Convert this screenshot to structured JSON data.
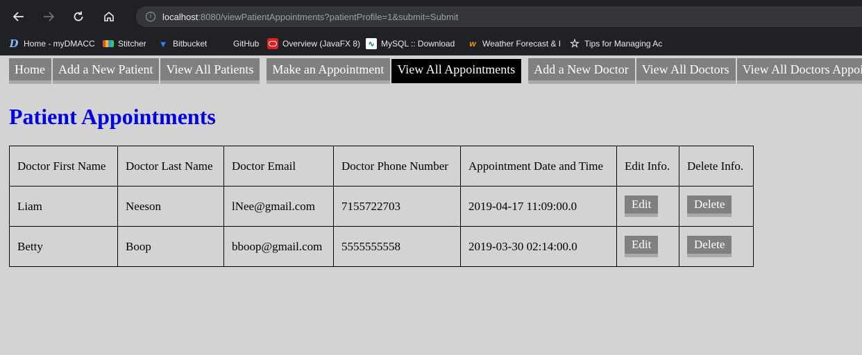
{
  "browser": {
    "url_host": "localhost",
    "url_rest": ":8080/viewPatientAppointments?patientProfile=1&submit=Submit",
    "bookmarks": [
      {
        "label": "Home - myDMACC",
        "icon": "d-logo-icon"
      },
      {
        "label": "Stitcher",
        "icon": "stitcher-icon"
      },
      {
        "label": "Bitbucket",
        "icon": "bitbucket-icon"
      },
      {
        "label": "GitHub",
        "icon": "github-icon"
      },
      {
        "label": "Overview (JavaFX 8)",
        "icon": "oracle-icon"
      },
      {
        "label": "MySQL :: Download M",
        "icon": "mysql-icon"
      },
      {
        "label": "Weather Forecast & F",
        "icon": "weather-icon"
      },
      {
        "label": "Tips for Managing Ac",
        "icon": "star-icon"
      }
    ]
  },
  "menu": {
    "items": [
      "Home",
      "Add a New Patient",
      "View All Patients",
      "Make an Appointment",
      "View All Appointments",
      "Add a New Doctor",
      "View All Doctors",
      "View All Doctors Appoin"
    ]
  },
  "page_title": "Patient Appointments",
  "table": {
    "headers": [
      "Doctor First Name",
      "Doctor Last Name",
      "Doctor Email",
      "Doctor Phone Number",
      "Appointment Date and Time",
      "Edit Info.",
      "Delete Info."
    ],
    "rows": [
      {
        "first": "Liam",
        "last": "Neeson",
        "email": "lNee@gmail.com",
        "phone": "7155722703",
        "datetime": "2019-04-17 11:09:00.0",
        "edit": "Edit",
        "delete": "Delete"
      },
      {
        "first": "Betty",
        "last": "Boop",
        "email": "bboop@gmail.com",
        "phone": "5555555558",
        "datetime": "2019-03-30 02:14:00.0",
        "edit": "Edit",
        "delete": "Delete"
      }
    ]
  },
  "colors": {
    "page_bg": "#d3d3d3",
    "title": "#0000e6",
    "menu_item": "#808080",
    "menu_active": "#000000"
  }
}
